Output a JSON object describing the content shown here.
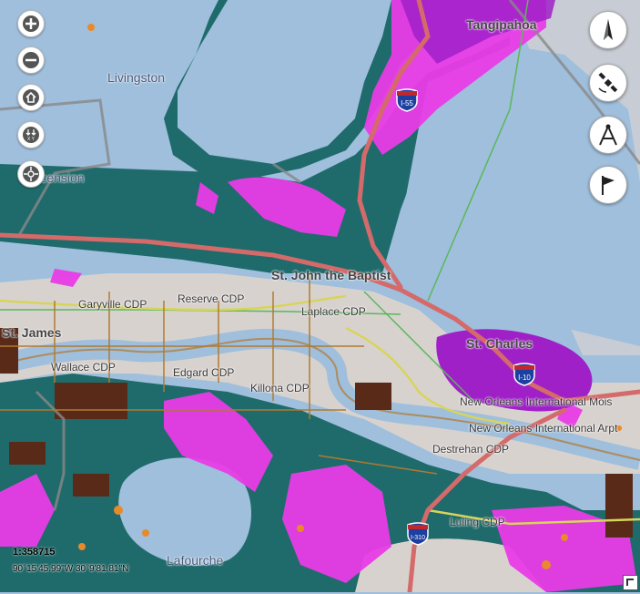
{
  "map": {
    "place_labels": [
      {
        "id": "tangipahoa",
        "text": "Tangipahoa"
      },
      {
        "id": "livingston",
        "text": "Livingston"
      },
      {
        "id": "ascension",
        "text": "Ascension"
      },
      {
        "id": "st-john",
        "text": "St. John the Baptist"
      },
      {
        "id": "garyville",
        "text": "Garyville CDP"
      },
      {
        "id": "reserve",
        "text": "Reserve CDP"
      },
      {
        "id": "laplace",
        "text": "Laplace CDP"
      },
      {
        "id": "st-james",
        "text": "St. James"
      },
      {
        "id": "wallace",
        "text": "Wallace CDP"
      },
      {
        "id": "edgard",
        "text": "Edgard CDP"
      },
      {
        "id": "killona",
        "text": "Killona CDP"
      },
      {
        "id": "charles",
        "text": "St. Charles"
      },
      {
        "id": "msy-intl",
        "text": "New Orleans International Mois"
      },
      {
        "id": "msy-arpt",
        "text": "New Orleans International Arpt"
      },
      {
        "id": "destrehan",
        "text": "Destrehan CDP"
      },
      {
        "id": "luling",
        "text": "Luling CDP"
      },
      {
        "id": "lafourche",
        "text": "Lafourche"
      }
    ],
    "highways": [
      {
        "id": "i55",
        "text": "I-55"
      },
      {
        "id": "i10",
        "text": "I-10"
      },
      {
        "id": "i310",
        "text": "I-310"
      }
    ],
    "scale": "1:358715",
    "coordinates": "90°15'45.99\"W  30°9'81.81\"N",
    "colors": {
      "water": "#9fbfdc",
      "wetland": "#1f6b6b",
      "urban": "#d8d2cf",
      "highlight": "#e93ce6",
      "parish_purple": "#a020c8",
      "road": "#d46a6a",
      "river_outline": "#b08040"
    }
  },
  "controls": {
    "left": [
      "zoom-in-icon",
      "zoom-out-icon",
      "home-icon",
      "xy-coordinates-icon",
      "pan-crosshair-icon"
    ],
    "right": [
      "north-arrow-icon",
      "satellite-icon",
      "measure-compass-icon",
      "flag-icon"
    ]
  }
}
